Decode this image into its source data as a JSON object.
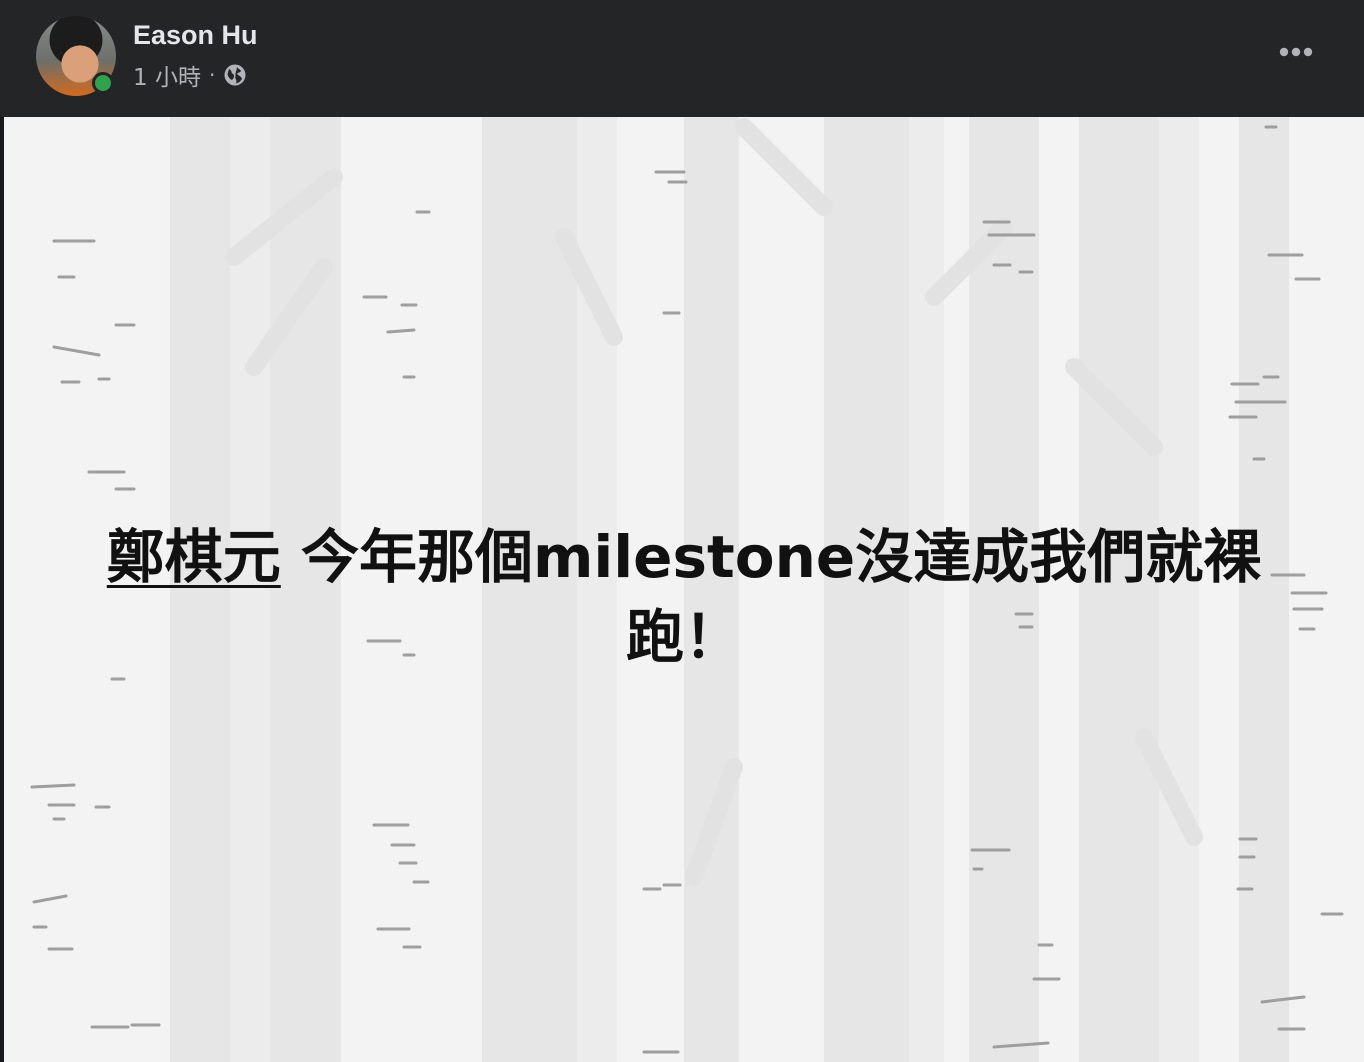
{
  "post": {
    "author": "Eason Hu",
    "time": "1 小時",
    "separator": "·",
    "privacy_icon": "globe-icon",
    "menu_icon": "more-horizontal-icon",
    "mention": "鄭棋元",
    "text_line1": " 今年那個milestone沒達成我們就裸",
    "text_line2": "跑！",
    "background_style": "birch-forest"
  },
  "colors": {
    "header_bg": "#242526",
    "online": "#31a24c",
    "text_primary": "#e4e6eb",
    "text_secondary": "#b0b3b8"
  }
}
